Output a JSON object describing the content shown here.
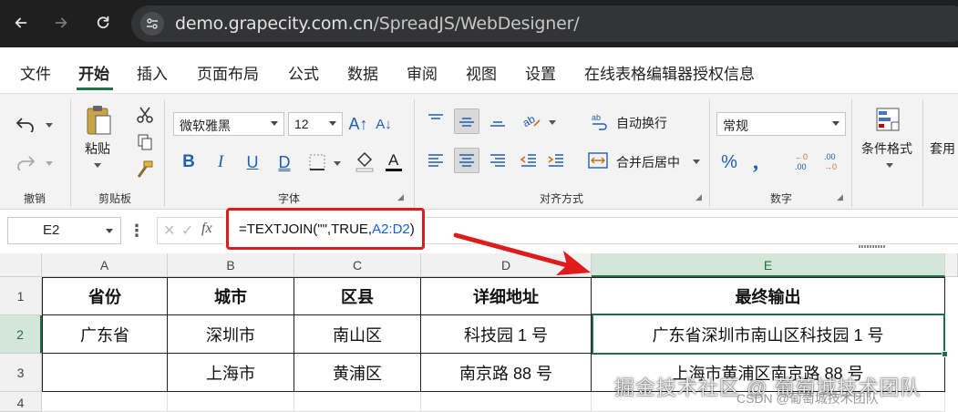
{
  "browser": {
    "url_host": "demo.grapecity.com.cn",
    "url_path": "/SpreadJS/WebDesigner/"
  },
  "ribbon_tabs": [
    "文件",
    "开始",
    "插入",
    "页面布局",
    "公式",
    "数据",
    "审阅",
    "视图",
    "设置",
    "在线表格编辑器授权信息"
  ],
  "active_tab": "开始",
  "ribbon": {
    "undo_group": "撤销",
    "clipboard": {
      "paste": "粘贴",
      "label": "剪贴板"
    },
    "font": {
      "family": "微软雅黑",
      "size": "12",
      "label": "字体"
    },
    "alignment": {
      "wrap": "自动换行",
      "merge": "合并后居中",
      "label": "对齐方式"
    },
    "number": {
      "format": "常规",
      "label": "数字"
    },
    "styles": {
      "conditional": "条件格式",
      "table": "套用"
    }
  },
  "formula_bar": {
    "name_box": "E2",
    "fx": "fx",
    "formula_prefix": "=TEXTJOIN(\"\",TRUE,",
    "formula_ref": "A2:D2",
    "formula_suffix": ")"
  },
  "sheet": {
    "columns": [
      "A",
      "B",
      "C",
      "D",
      "E"
    ],
    "selected_column": "E",
    "rows": [
      "1",
      "2",
      "3",
      "4"
    ],
    "selected_row": "2",
    "headers": [
      "省份",
      "城市",
      "区县",
      "详细地址",
      "最终输出"
    ],
    "data": [
      [
        "广东省",
        "深圳市",
        "南山区",
        "科技园 1 号",
        "广东省深圳市南山区科技园 1 号"
      ],
      [
        "",
        "上海市",
        "黄浦区",
        "南京路 88 号",
        "上海市黄浦区南京路 88 号"
      ]
    ]
  },
  "watermark": "掘金技术社区 @ 葡萄城技术团队",
  "watermark_small": "CSDN @葡萄城技术团队",
  "colors": {
    "accent": "#1e7145",
    "annotation": "#e01b1b",
    "ref": "#1560d4"
  }
}
